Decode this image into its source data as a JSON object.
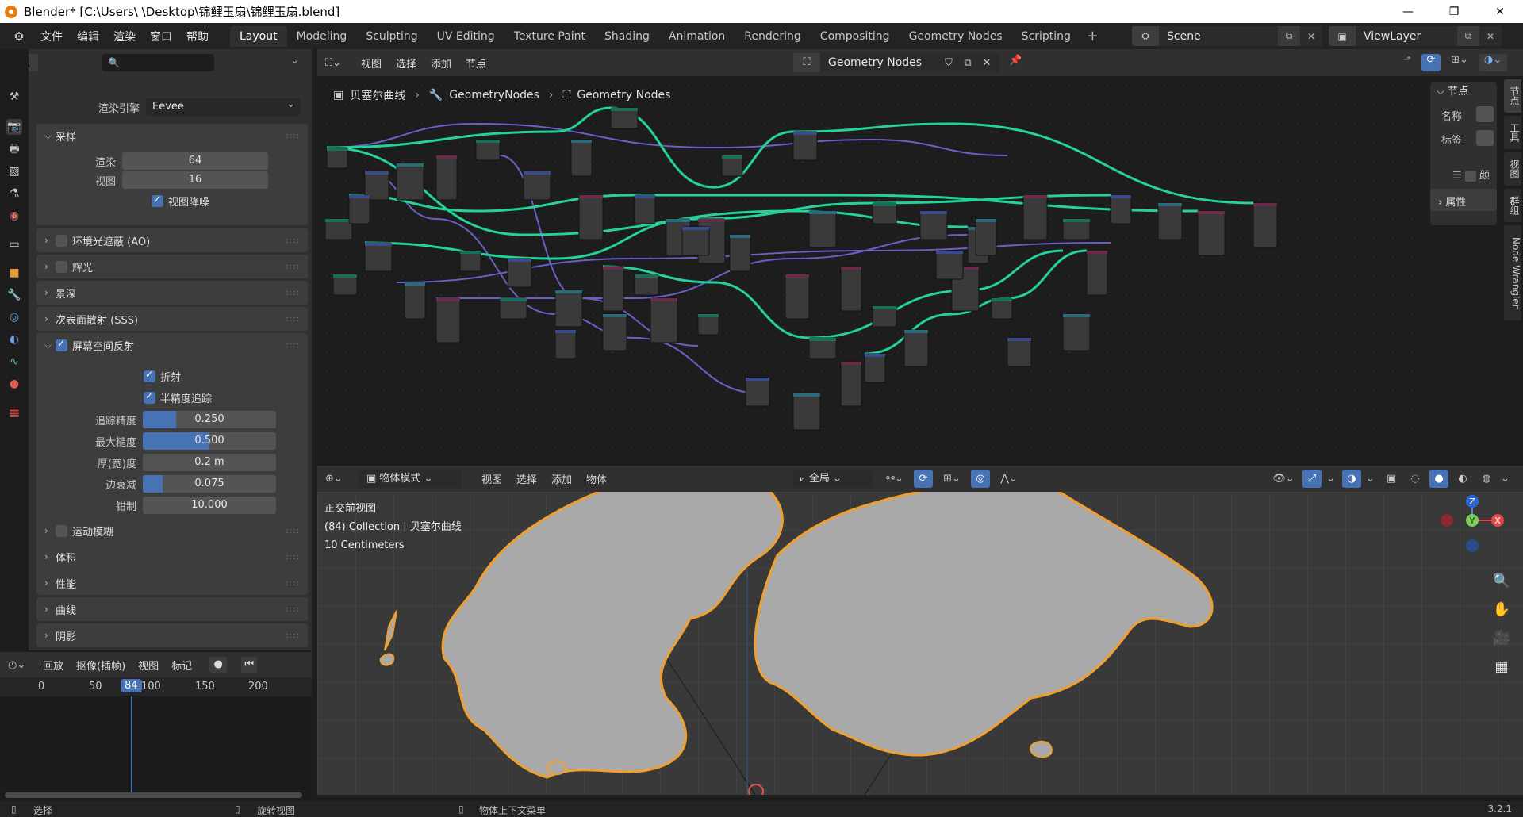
{
  "window": {
    "title": "Blender* [C:\\Users\\  \\Desktop\\锦鲤玉扇\\锦鲤玉扇.blend]",
    "controls": [
      "—",
      "❐",
      "✕"
    ]
  },
  "menubar": {
    "menus": [
      "文件",
      "编辑",
      "渲染",
      "窗口",
      "帮助"
    ],
    "workspaces": [
      "Layout",
      "Modeling",
      "Sculpting",
      "UV Editing",
      "Texture Paint",
      "Shading",
      "Animation",
      "Rendering",
      "Compositing",
      "Geometry Nodes",
      "Scripting"
    ],
    "active_workspace": "Layout",
    "scene": "Scene",
    "view_layer": "ViewLayer"
  },
  "properties": {
    "render_engine_label": "渲染引擎",
    "render_engine": "Eevee",
    "sampling": {
      "title": "采样",
      "render_label": "渲染",
      "render_value": "64",
      "viewport_label": "视图",
      "viewport_value": "16",
      "denoise_label": "视图降噪"
    },
    "collapsed_top": [
      "环境光遮蔽 (AO)",
      "辉光",
      "景深",
      "次表面散射 (SSS)"
    ],
    "ssr": {
      "title": "屏幕空间反射",
      "refraction": "折射",
      "half_res": "半精度追踪",
      "trace_precision_label": "追踪精度",
      "trace_precision": "0.250",
      "trace_precision_fraction": 0.25,
      "max_roughness_label": "最大糙度",
      "max_roughness": "0.500",
      "max_roughness_fraction": 0.5,
      "thickness_label": "厚(宽)度",
      "thickness": "0.2 m",
      "edge_fade_label": "边衰减",
      "edge_fade": "0.075",
      "edge_fade_fraction": 0.15,
      "clamp_label": "钳制",
      "clamp": "10.000"
    },
    "collapsed_bottom": [
      "运动模糊",
      "体积",
      "性能",
      "曲线",
      "阴影"
    ]
  },
  "timeline": {
    "menus": [
      "回放",
      "抠像(插帧)",
      "视图",
      "标记"
    ],
    "ticks": [
      "0",
      "50",
      "100",
      "150",
      "200"
    ],
    "current_frame": "84"
  },
  "node_editor": {
    "menus": [
      "视图",
      "选择",
      "添加",
      "节点"
    ],
    "node_tree": "Geometry Nodes",
    "breadcrumb": [
      "贝塞尔曲线",
      "GeometryNodes",
      "Geometry Nodes"
    ],
    "sidebar": {
      "node_header": "节点",
      "name_label": "名称",
      "label_label": "标签",
      "color_label": "颜",
      "properties_header": "属性"
    },
    "vertical_tabs": [
      "节点",
      "工具",
      "视图",
      "群组",
      "Node Wrangler"
    ]
  },
  "viewport": {
    "menus": [
      "物体模式",
      "视图",
      "选择",
      "添加",
      "物体"
    ],
    "transform": "全局",
    "view_name": "正交前视图",
    "collection_info": "(84) Collection | 贝塞尔曲线",
    "scale_info": "10 Centimeters",
    "gizmo_axes": [
      "Z",
      "Y",
      "X"
    ]
  },
  "statusbar": {
    "select": "选择",
    "rotate": "旋转视图",
    "context_menu": "物体上下文菜单",
    "version": "3.2.1"
  },
  "colors": {
    "accent": "#4772b3",
    "node_link_green": "#25d29a",
    "node_link_purple": "#6c5fc7",
    "selection_orange": "#f0a030"
  }
}
